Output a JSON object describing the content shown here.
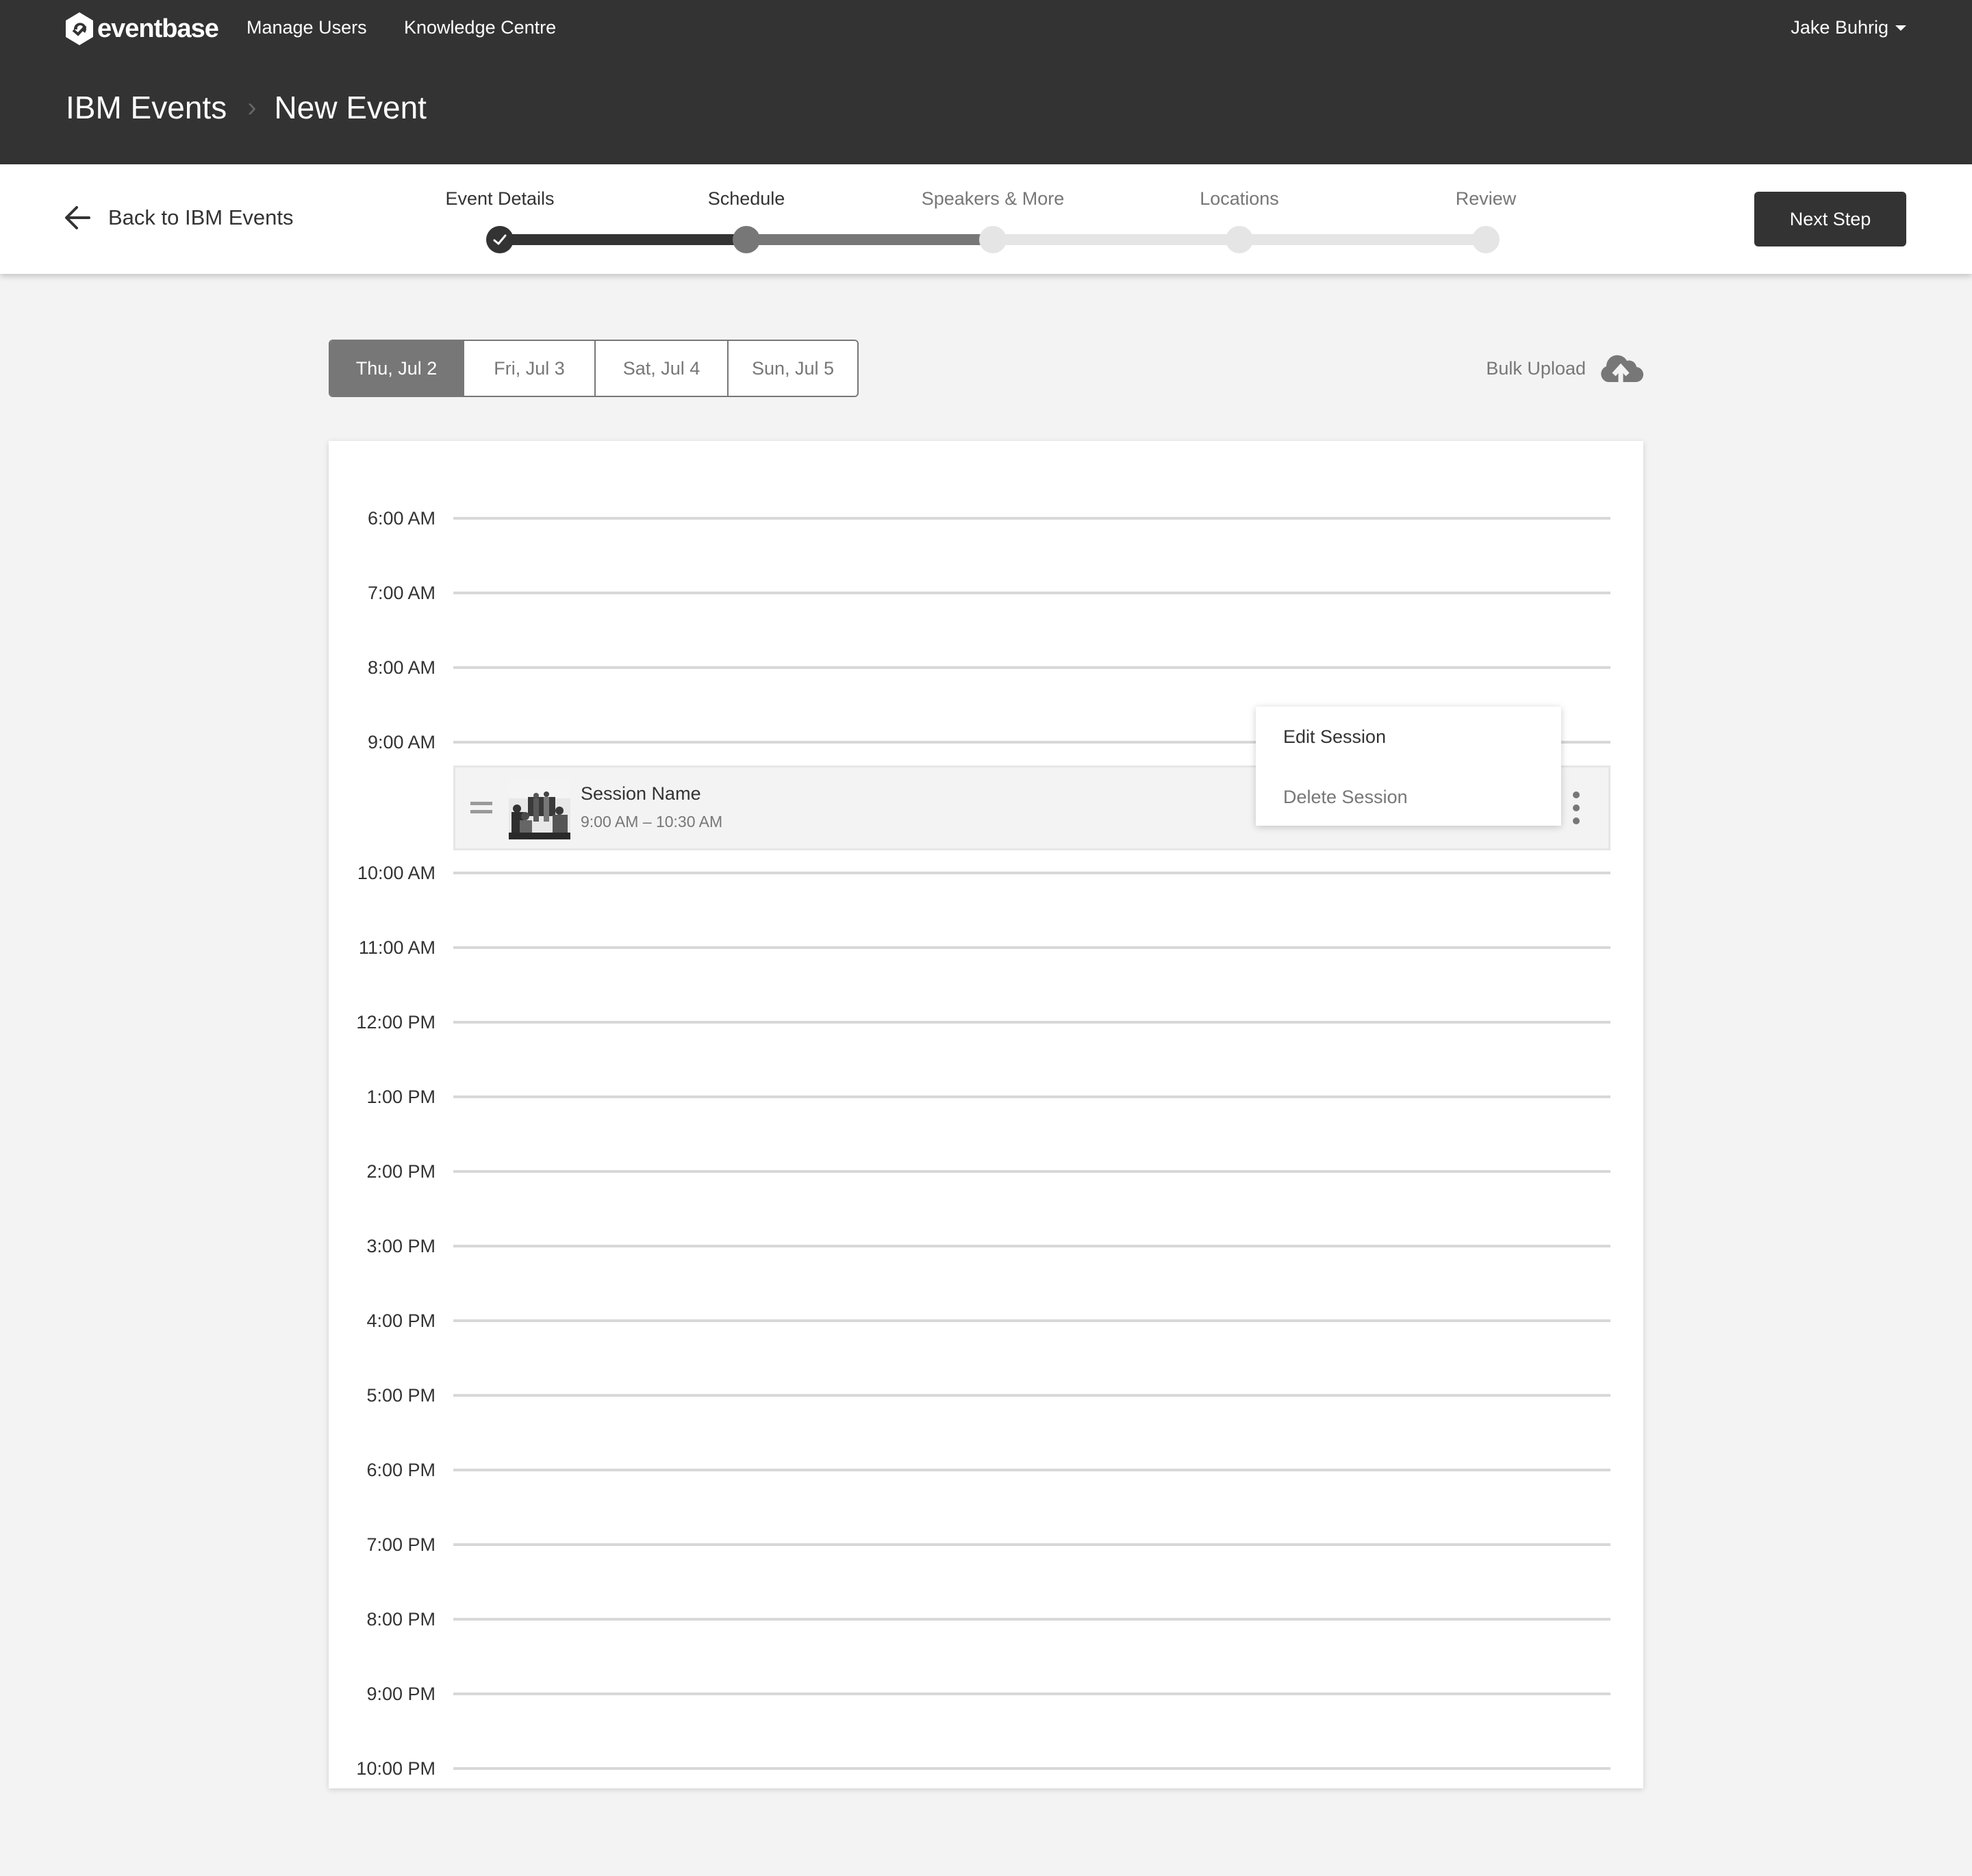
{
  "header": {
    "logo_text": "eventbase",
    "nav": [
      {
        "label": "Manage Users"
      },
      {
        "label": "Knowledge Centre"
      }
    ],
    "user_name": "Jake Buhrig",
    "breadcrumb": [
      {
        "label": "IBM Events"
      },
      {
        "label": "New Event"
      }
    ],
    "breadcrumb_separator": "›"
  },
  "stepbar": {
    "back_label": "Back to IBM Events",
    "steps": [
      {
        "label": "Event Details",
        "state": "done"
      },
      {
        "label": "Schedule",
        "state": "current"
      },
      {
        "label": "Speakers & More",
        "state": "todo"
      },
      {
        "label": "Locations",
        "state": "todo"
      },
      {
        "label": "Review",
        "state": "todo"
      }
    ],
    "next_label": "Next Step"
  },
  "schedule": {
    "day_tabs": [
      {
        "label": "Thu, Jul 2",
        "active": true
      },
      {
        "label": "Fri, Jul 3",
        "active": false
      },
      {
        "label": "Sat, Jul 4",
        "active": false
      },
      {
        "label": "Sun, Jul 5",
        "active": false
      }
    ],
    "bulk_upload_label": "Bulk Upload",
    "hours": [
      "6:00 AM",
      "7:00 AM",
      "8:00 AM",
      "9:00 AM",
      "10:00 AM",
      "11:00 AM",
      "12:00 PM",
      "1:00 PM",
      "2:00 PM",
      "3:00 PM",
      "4:00 PM",
      "5:00 PM",
      "6:00 PM",
      "7:00 PM",
      "8:00 PM",
      "9:00 PM",
      "10:00 PM"
    ],
    "session": {
      "name": "Session Name",
      "time": "9:00 AM – 10:30 AM"
    },
    "context_menu": {
      "edit_label": "Edit Session",
      "delete_label": "Delete Session"
    }
  },
  "colors": {
    "header_bg": "#333333",
    "page_bg": "#f3f3f3",
    "accent_dark": "#333333",
    "accent_mid": "#777777",
    "inactive": "#e5e5e5"
  }
}
